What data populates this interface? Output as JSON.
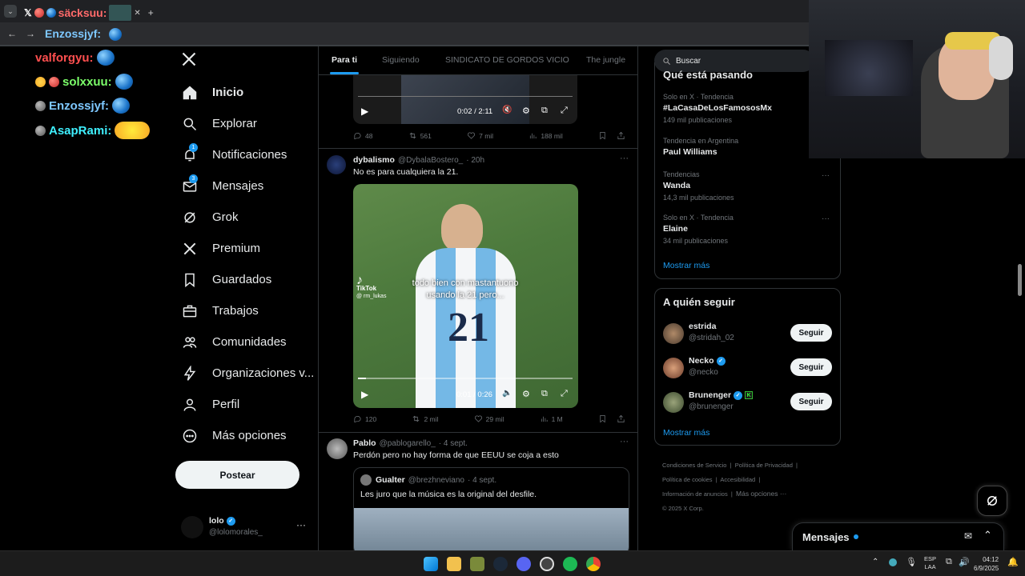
{
  "browser": {
    "tab_text": "säcksuu:",
    "address_text": "Enzossjyf:",
    "new_tab": "+"
  },
  "chat": [
    {
      "user": "valforgyu:",
      "color": "#ff4f4f",
      "badge": "none"
    },
    {
      "user": "solxxuu:",
      "color": "#7cff6a",
      "badge": "gold"
    },
    {
      "user": "Enzossjyf:",
      "color": "#7ec8ff",
      "badge": "gray"
    },
    {
      "user": "AsapRami:",
      "color": "#3ff0ff",
      "badge": "gray"
    }
  ],
  "nav": {
    "items": [
      {
        "label": "Inicio",
        "icon": "home-icon"
      },
      {
        "label": "Explorar",
        "icon": "search-icon"
      },
      {
        "label": "Notificaciones",
        "icon": "bell-icon",
        "badge": "1"
      },
      {
        "label": "Mensajes",
        "icon": "mail-icon",
        "badge": "3"
      },
      {
        "label": "Grok",
        "icon": "grok-icon"
      },
      {
        "label": "Premium",
        "icon": "x-icon"
      },
      {
        "label": "Guardados",
        "icon": "bookmark-icon"
      },
      {
        "label": "Trabajos",
        "icon": "briefcase-icon"
      },
      {
        "label": "Comunidades",
        "icon": "people-icon"
      },
      {
        "label": "Organizaciones v...",
        "icon": "lightning-icon"
      },
      {
        "label": "Perfil",
        "icon": "person-icon"
      },
      {
        "label": "Más opciones",
        "icon": "more-circle-icon"
      }
    ],
    "post_button": "Postear",
    "account": {
      "name": "lolo",
      "handle": "@lolomorales_"
    }
  },
  "tabs": [
    "Para ti",
    "Siguiendo",
    "SINDICATO DE GORDOS VICIO",
    "The jungle"
  ],
  "tweets": [
    {
      "video_time": "0:02 / 2:11",
      "stats": {
        "replies": "48",
        "reposts": "561",
        "likes": "7 mil",
        "views": "188 mil"
      }
    },
    {
      "name": "dybalismo",
      "handle": "@DybalaBostero_",
      "time": "· 20h",
      "text": "No es para cualquiera la 21.",
      "video_caption": "todo bien con mastantuono usando la 21 pero...",
      "tiktok": "TikTok",
      "tiktok_user": "@ rm_lukas",
      "jersey_number": "21",
      "video_time": "0:01 / 0:26",
      "stats": {
        "replies": "120",
        "reposts": "2 mil",
        "likes": "29 mil",
        "views": "1 M"
      }
    },
    {
      "name": "Pablo",
      "handle": "@pablogarello_",
      "time": "· 4 sept.",
      "text": "Perdón pero no hay forma de que EEUU se coja a esto",
      "quote": {
        "name": "Gualter",
        "handle": "@brezhneviano",
        "time": "· 4 sept.",
        "text": "Les juro que la música es la original del desfile."
      }
    }
  ],
  "search": {
    "placeholder": "Buscar"
  },
  "trends": {
    "title": "Qué está pasando",
    "items": [
      {
        "context": "Solo en X · Tendencia",
        "name": "#LaCasaDeLosFamososMx",
        "count": "149 mil publicaciones"
      },
      {
        "context": "Tendencia en Argentina",
        "name": "Paul Williams",
        "count": ""
      },
      {
        "context": "Tendencias",
        "name": "Wanda",
        "count": "14,3 mil publicaciones"
      },
      {
        "context": "Solo en X · Tendencia",
        "name": "Elaine",
        "count": "34 mil publicaciones"
      }
    ],
    "show_more": "Mostrar más"
  },
  "who_to_follow": {
    "title": "A quién seguir",
    "users": [
      {
        "name": "estrida",
        "handle": "@stridah_02",
        "verified": false
      },
      {
        "name": "Necko",
        "handle": "@necko",
        "verified": true
      },
      {
        "name": "Brunenger",
        "handle": "@brunenger",
        "verified": true
      }
    ],
    "follow_label": "Seguir",
    "show_more": "Mostrar más"
  },
  "footer": {
    "links": [
      "Condiciones de Servicio",
      "Política de Privacidad",
      "Política de cookies",
      "Accesibilidad",
      "Información de anuncios",
      "Más opciones ···"
    ],
    "copyright": "© 2025 X Corp."
  },
  "messages_drawer": {
    "label": "Mensajes"
  },
  "taskbar": {
    "lang_top": "ESP",
    "lang_bottom": "LAA",
    "time": "04:12",
    "date": "6/9/2025"
  },
  "colors": {
    "accent": "#1d9bf0",
    "background": "#000000",
    "border": "#2f3336"
  }
}
